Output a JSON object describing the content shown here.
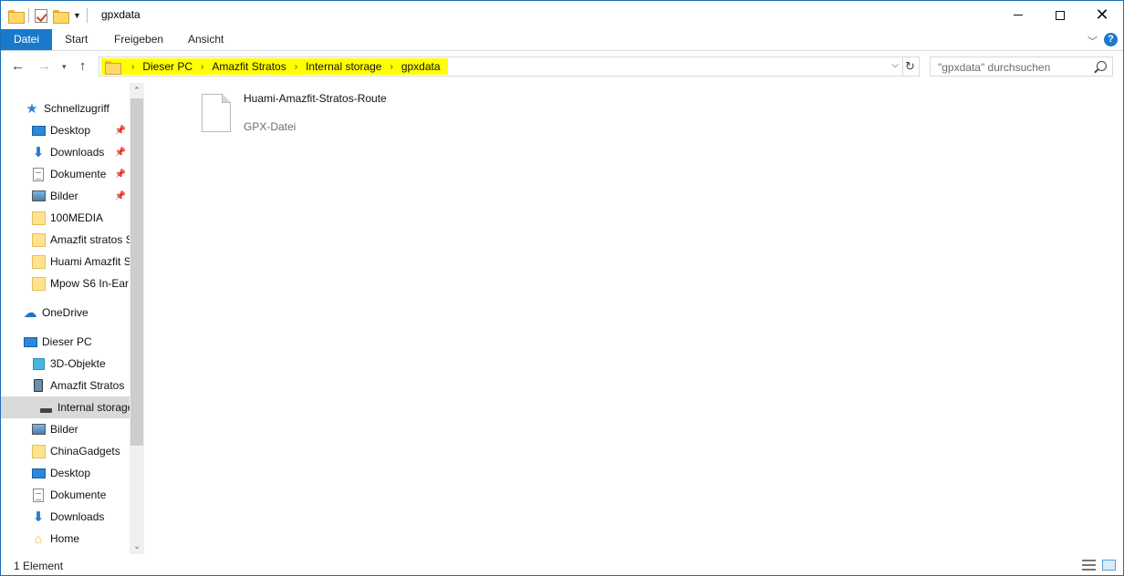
{
  "window": {
    "title": "gpxdata",
    "controls": {
      "minimize": "minimize",
      "maximize": "maximize",
      "close": "✕"
    }
  },
  "ribbon": {
    "tabs": [
      {
        "label": "Datei",
        "active": true
      },
      {
        "label": "Start"
      },
      {
        "label": "Freigeben"
      },
      {
        "label": "Ansicht"
      }
    ],
    "help": "?"
  },
  "address": {
    "breadcrumbs": [
      "Dieser PC",
      "Amazfit Stratos",
      "Internal storage",
      "gpxdata"
    ],
    "highlight_color": "#ffff00"
  },
  "search": {
    "placeholder": "\"gpxdata\" durchsuchen"
  },
  "nav_pane": {
    "items": [
      {
        "label": "Schnellzugriff",
        "icon": "star-icon"
      },
      {
        "label": "Desktop",
        "icon": "desktop-icon",
        "pinned": true
      },
      {
        "label": "Downloads",
        "icon": "downloads-icon",
        "pinned": true
      },
      {
        "label": "Dokumente",
        "icon": "documents-icon",
        "pinned": true
      },
      {
        "label": "Bilder",
        "icon": "pictures-icon",
        "pinned": true
      },
      {
        "label": "100MEDIA",
        "icon": "folder-icon"
      },
      {
        "label": "Amazfit stratos S",
        "icon": "folder-icon"
      },
      {
        "label": "Huami Amazfit S",
        "icon": "folder-icon"
      },
      {
        "label": "Mpow S6 In-Ear",
        "icon": "folder-icon"
      },
      {
        "label": "OneDrive",
        "icon": "cloud-icon"
      },
      {
        "label": "Dieser PC",
        "icon": "computer-icon"
      },
      {
        "label": "3D-Objekte",
        "icon": "cube-icon"
      },
      {
        "label": "Amazfit Stratos",
        "icon": "device-icon"
      },
      {
        "label": "Internal storage",
        "icon": "drive-icon",
        "selected": true
      },
      {
        "label": "Bilder",
        "icon": "pictures-icon"
      },
      {
        "label": "ChinaGadgets",
        "icon": "network-folder-icon"
      },
      {
        "label": "Desktop",
        "icon": "desktop-icon"
      },
      {
        "label": "Dokumente",
        "icon": "documents-icon"
      },
      {
        "label": "Downloads",
        "icon": "downloads-icon"
      },
      {
        "label": "Home",
        "icon": "home-icon"
      }
    ]
  },
  "files": [
    {
      "name": "Huami-Amazfit-Stratos-Route",
      "type": "GPX-Datei",
      "icon": "file-icon"
    }
  ],
  "status": {
    "count": "1 Element"
  }
}
